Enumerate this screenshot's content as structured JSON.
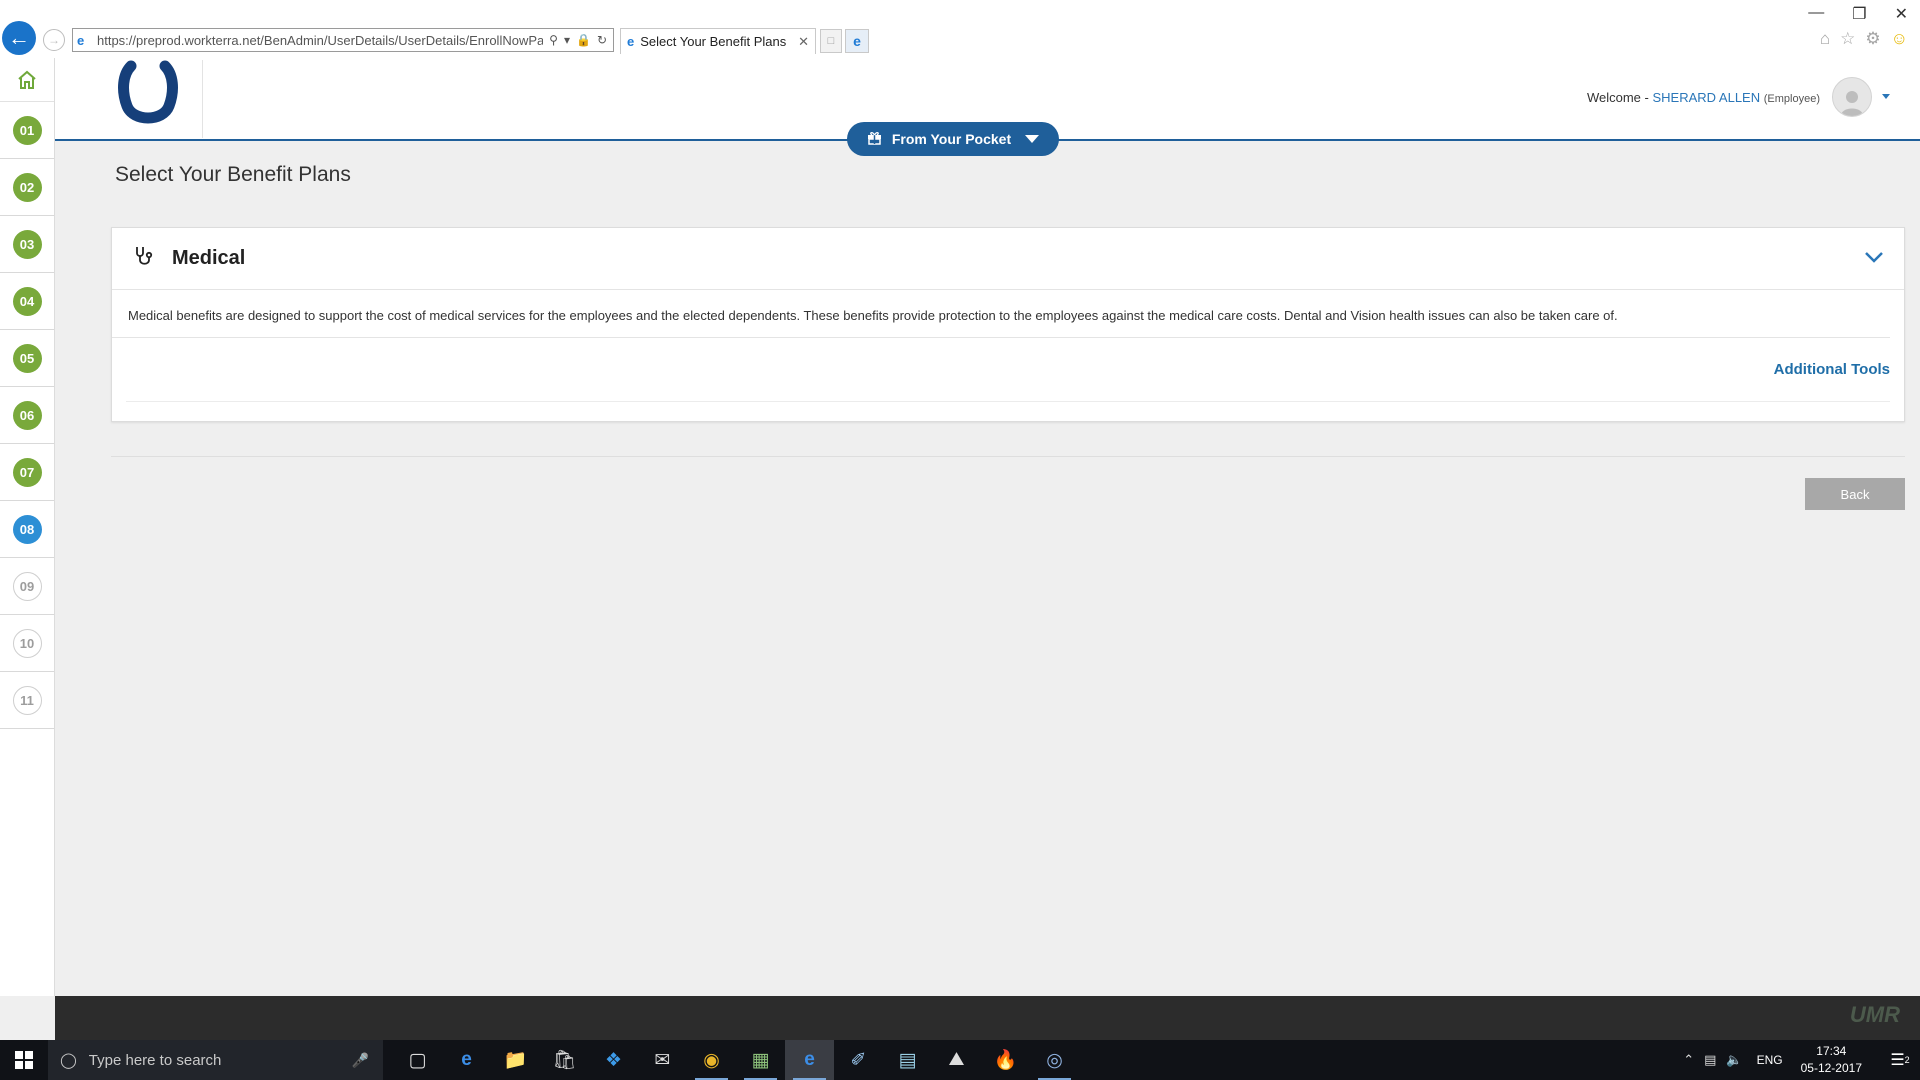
{
  "browser": {
    "url": "https://preprod.workterra.net/BenAdmin/UserDetails/UserDetails/EnrollNowPage?Pa",
    "tab_title": "Select Your Benefit Plans"
  },
  "steps": [
    {
      "label": "01",
      "state": "done"
    },
    {
      "label": "02",
      "state": "done"
    },
    {
      "label": "03",
      "state": "done"
    },
    {
      "label": "04",
      "state": "done"
    },
    {
      "label": "05",
      "state": "done"
    },
    {
      "label": "06",
      "state": "done"
    },
    {
      "label": "07",
      "state": "done"
    },
    {
      "label": "08",
      "state": "current"
    },
    {
      "label": "09",
      "state": "todo"
    },
    {
      "label": "10",
      "state": "todo"
    },
    {
      "label": "11",
      "state": "todo"
    }
  ],
  "header": {
    "welcome_label": "Welcome -",
    "user_name": "SHERARD ALLEN",
    "user_role": "(Employee)",
    "pocket_label": "From Your Pocket"
  },
  "main": {
    "page_title": "Select Your Benefit Plans",
    "card": {
      "title": "Medical",
      "description": "Medical benefits are designed to support the cost of medical services for the employees and the elected dependents. These benefits provide protection to the employees against the medical care costs. Dental and Vision health issues can also be taken care of.",
      "tools_link": "Additional Tools"
    },
    "back_label": "Back"
  },
  "footer": {
    "brand": "UMR"
  },
  "taskbar": {
    "search_placeholder": "Type here to search",
    "language": "ENG",
    "time": "17:34",
    "date": "05-12-2017",
    "notification_count": "2"
  },
  "colors": {
    "step_done": "#79a93b",
    "step_current": "#2d8fd5",
    "brand_blue": "#1f5f9a",
    "link_blue": "#1f6ea8"
  }
}
